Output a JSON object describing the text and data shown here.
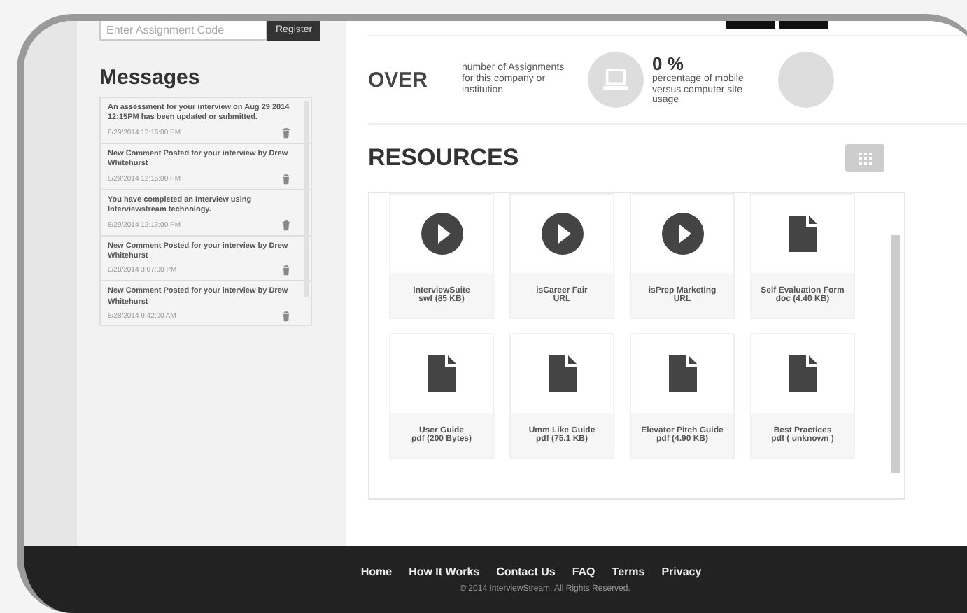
{
  "assignment": {
    "placeholder": "Enter Assignment Code",
    "button": "Register"
  },
  "messages": {
    "title": "Messages",
    "items": [
      {
        "text": "An assessment for your interview on Aug 29 2014 12:15PM has been updated or submitted.",
        "date": "8/29/2014 12:16:00 PM"
      },
      {
        "text": "New Comment Posted for your interview by Drew Whitehurst",
        "date": "8/29/2014 12:15:00 PM"
      },
      {
        "text": "You have completed an Interview using Interviewstream technology.",
        "date": "8/29/2014 12:13:00 PM"
      },
      {
        "text": "New Comment Posted for your interview by Drew Whitehurst",
        "date": "8/28/2014 3:07:00 PM"
      },
      {
        "text": "New Comment Posted for your interview by Drew Whitehurst",
        "date": "8/28/2014 9:42:00 AM"
      }
    ]
  },
  "overview": {
    "title": "OVER",
    "stats": [
      {
        "kind": "count",
        "label": "number of Assignments for this company or institution"
      },
      {
        "kind": "computer",
        "value": "0 %",
        "label": "percentage of mobile versus computer site usage"
      },
      {
        "kind": "other"
      }
    ]
  },
  "resources": {
    "title": "RESOURCES",
    "items": [
      {
        "kind": "video",
        "name": "InterviewSuite",
        "info": "swf (85 KB)"
      },
      {
        "kind": "video",
        "name": "isCareer Fair",
        "info": "URL"
      },
      {
        "kind": "video",
        "name": "isPrep Marketing",
        "info": "URL"
      },
      {
        "kind": "doc",
        "name": "Self Evaluation Form",
        "info": "doc (4.40 KB)"
      },
      {
        "kind": "doc",
        "name": "User Guide",
        "info": "pdf (200 Bytes)"
      },
      {
        "kind": "doc",
        "name": "Umm Like Guide",
        "info": "pdf (75.1 KB)"
      },
      {
        "kind": "doc",
        "name": "Elevator Pitch Guide",
        "info": "pdf (4.90 KB)"
      },
      {
        "kind": "doc",
        "name": "Best Practices",
        "info": "pdf ( unknown )"
      }
    ]
  },
  "footer": {
    "links": [
      "Home",
      "How It Works",
      "Contact Us",
      "FAQ",
      "Terms",
      "Privacy"
    ],
    "copyright": "© 2014 InterviewStream. All Rights Reserved."
  }
}
